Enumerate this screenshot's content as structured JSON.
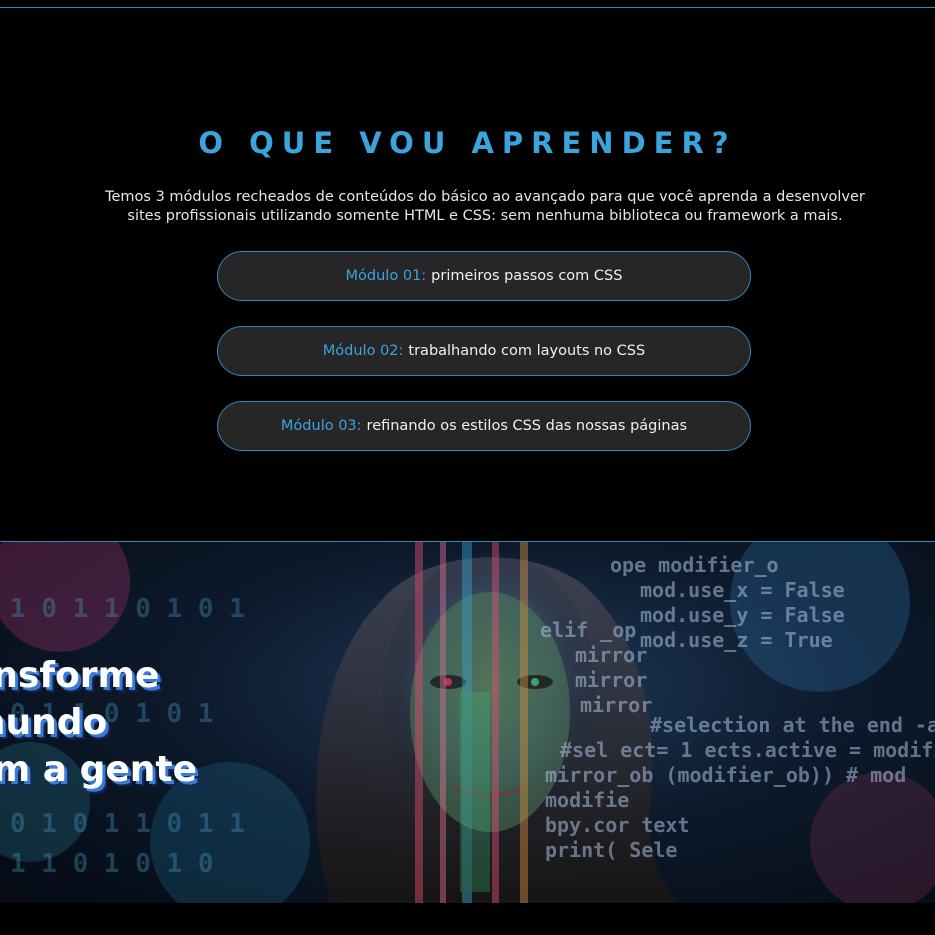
{
  "learn": {
    "title": "O QUE VOU APRENDER?",
    "description": "Temos 3 módulos recheados de conteúdos do básico ao avançado para que você aprenda a desenvolver sites profissionais utilizando somente HTML e CSS: sem nenhuma biblioteca ou framework a mais.",
    "modules": [
      {
        "label": "Módulo 01:",
        "text": "primeiros passos com CSS"
      },
      {
        "label": "Módulo 02:",
        "text": "trabalhando com layouts no CSS"
      },
      {
        "label": "Módulo 03:",
        "text": "refinando os estilos CSS das nossas páginas"
      }
    ]
  },
  "banner": {
    "lines": [
      "ansforme",
      "mundo",
      "om a gente"
    ],
    "image": "woman-face-with-code-projection"
  },
  "colors": {
    "accent": "#3aa4dc",
    "border": "#2e86c1",
    "module_bg": "#262626",
    "page_bg": "#000000"
  }
}
